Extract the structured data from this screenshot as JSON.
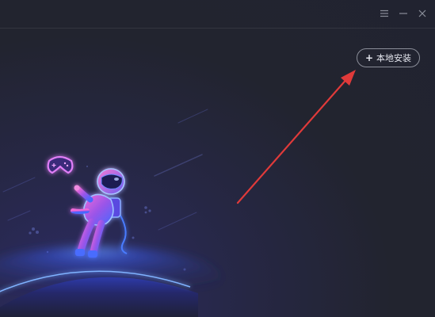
{
  "titlebar": {
    "icons": [
      "menu-icon",
      "minimize-icon",
      "close-icon"
    ]
  },
  "toolbar": {
    "local_install_label": "本地安装",
    "local_install_icon": "plus-icon"
  },
  "illustration": {
    "subject": "astronaut-with-gamepad",
    "colors": {
      "background": "#232530",
      "planet_glow": "#3b6cff",
      "astronaut_pink": "#e35bd8",
      "astronaut_blue": "#4a6cff",
      "gamepad": "#c86df0"
    }
  },
  "annotation": {
    "arrow_color": "#e03a3a"
  }
}
